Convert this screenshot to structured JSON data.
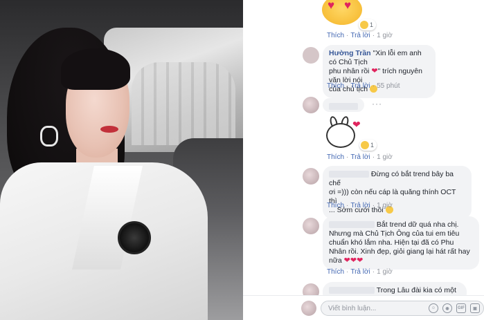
{
  "comments": [
    {
      "id": "c0",
      "text": "",
      "reaction_count": "1",
      "actions": {
        "like": "Thích",
        "reply": "Trả lời",
        "time": "1 giờ"
      }
    },
    {
      "id": "c1",
      "author": "Hường Trần",
      "text_1": "\"Xin lỗi em anh có Chủ Tịch",
      "text_2": "phu nhân rồi",
      "text_3": "\" trích nguyên văn lời nói",
      "text_4": "của chủ tịch",
      "actions": {
        "like": "Thích",
        "reply": "Trả lời",
        "time": "55 phút"
      }
    },
    {
      "id": "c2",
      "reaction_count": "1",
      "more": "···",
      "actions": {
        "like": "Thích",
        "reply": "Trả lời",
        "time": "1 giờ"
      }
    },
    {
      "id": "c3",
      "text_1": "Đừng có bắt trend bây ba chế",
      "text_2": "ơi =))) còn nếu cáp là quăng thính OCT thì",
      "text_3": "... Sớm cưới thôi",
      "actions": {
        "like": "Thích",
        "reply": "Trả lời",
        "time": "1 giờ"
      }
    },
    {
      "id": "c4",
      "text_1": "Bắt trend dữ quá nha chị.",
      "text_2": "Nhưng mà Chủ Tịch Ông của tui em tiêu",
      "text_3": "chuẩn khó lắm nha. Hiện tại đã có Phu",
      "text_4": "Nhân rồi. Xinh đẹp, giỏi giang lại hát rất hay",
      "text_5": "nữa",
      "actions": {
        "like": "Thích",
        "reply": "Trả lời",
        "time": "1 giờ"
      }
    },
    {
      "id": "c5",
      "text_1": "Trong Lâu đài kia có một"
    }
  ],
  "composer": {
    "placeholder": "Viết bình luận...",
    "icons": [
      "emoji-icon",
      "camera-icon",
      "gif-icon",
      "sticker-icon"
    ],
    "icon_glyphs": [
      "☺",
      "◉",
      "GIF",
      "▣"
    ]
  },
  "colors": {
    "link": "#4267b2",
    "name": "#385898",
    "bubble": "#f2f3f5",
    "heart": "#e0245e"
  }
}
